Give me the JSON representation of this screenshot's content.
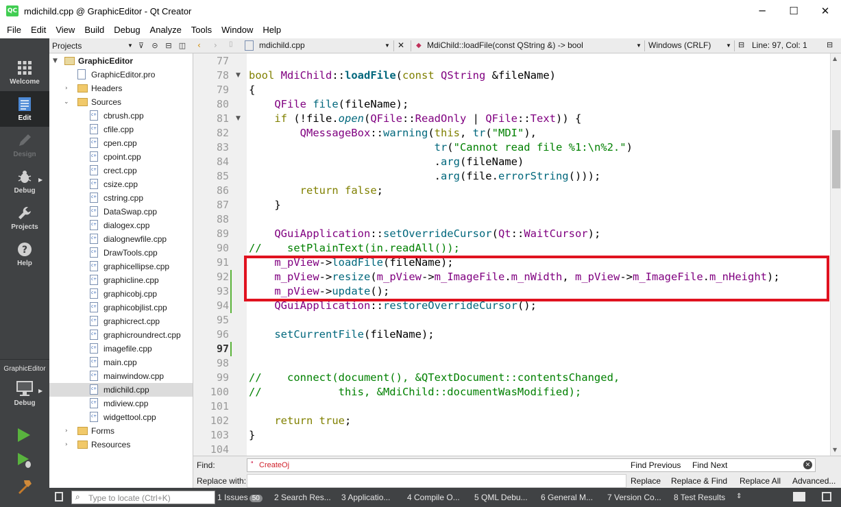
{
  "window": {
    "title": "mdichild.cpp @ GraphicEditor - Qt Creator",
    "app_icon": "QC",
    "controls": [
      "minimize-icon",
      "maximize-icon",
      "close-icon"
    ]
  },
  "menu": [
    "File",
    "Edit",
    "View",
    "Build",
    "Debug",
    "Analyze",
    "Tools",
    "Window",
    "Help"
  ],
  "modes": [
    {
      "label": "Welcome",
      "icon": "grid-icon"
    },
    {
      "label": "Edit",
      "icon": "document-icon"
    },
    {
      "label": "Design",
      "icon": "pen-icon"
    },
    {
      "label": "Debug",
      "icon": "bug-icon"
    },
    {
      "label": "Projects",
      "icon": "wrench-icon"
    },
    {
      "label": "Help",
      "icon": "question-icon"
    }
  ],
  "kit": {
    "project": "GraphicEditor",
    "mode": "Debug"
  },
  "projects_pane": {
    "title": "Projects",
    "tree": {
      "project": "GraphicEditor",
      "pro_file": "GraphicEditor.pro",
      "headers": "Headers",
      "sources": "Sources",
      "source_files": [
        "cbrush.cpp",
        "cfile.cpp",
        "cpen.cpp",
        "cpoint.cpp",
        "crect.cpp",
        "csize.cpp",
        "cstring.cpp",
        "DataSwap.cpp",
        "dialogex.cpp",
        "dialognewfile.cpp",
        "DrawTools.cpp",
        "graphicellipse.cpp",
        "graphicline.cpp",
        "graphicobj.cpp",
        "graphicobjlist.cpp",
        "graphicrect.cpp",
        "graphicroundrect.cpp",
        "imagefile.cpp",
        "main.cpp",
        "mainwindow.cpp",
        "mdichild.cpp",
        "mdiview.cpp",
        "widgettool.cpp"
      ],
      "selected_file": "mdichild.cpp",
      "forms": "Forms",
      "resources": "Resources"
    }
  },
  "editor_toolbar": {
    "file": "mdichild.cpp",
    "symbol": "MdiChild::loadFile(const QString &) -> bool",
    "line_endings": "Windows (CRLF)",
    "position": "Line: 97, Col: 1"
  },
  "code": {
    "current_line": "97",
    "lines": [
      {
        "n": "77",
        "t": ""
      },
      {
        "n": "78",
        "t": "bool MdiChild::loadFile(const QString &fileName)"
      },
      {
        "n": "79",
        "t": "{"
      },
      {
        "n": "80",
        "t": "    QFile file(fileName);"
      },
      {
        "n": "81",
        "t": "    if (!file.open(QFile::ReadOnly | QFile::Text)) {"
      },
      {
        "n": "82",
        "t": "        QMessageBox::warning(this, tr(\"MDI\"),"
      },
      {
        "n": "83",
        "t": "                             tr(\"Cannot read file %1:\\n%2.\")"
      },
      {
        "n": "84",
        "t": "                             .arg(fileName)"
      },
      {
        "n": "85",
        "t": "                             .arg(file.errorString()));"
      },
      {
        "n": "86",
        "t": "        return false;"
      },
      {
        "n": "87",
        "t": "    }"
      },
      {
        "n": "88",
        "t": ""
      },
      {
        "n": "89",
        "t": "    QGuiApplication::setOverrideCursor(Qt::WaitCursor);"
      },
      {
        "n": "90",
        "t": "//    setPlainText(in.readAll());"
      },
      {
        "n": "91",
        "t": "    m_pView->loadFile(fileName);"
      },
      {
        "n": "92",
        "t": "    m_pView->resize(m_pView->m_ImageFile.m_nWidth, m_pView->m_ImageFile.m_nHeight);"
      },
      {
        "n": "93",
        "t": "    m_pView->update();"
      },
      {
        "n": "94",
        "t": "    QGuiApplication::restoreOverrideCursor();"
      },
      {
        "n": "95",
        "t": ""
      },
      {
        "n": "96",
        "t": "    setCurrentFile(fileName);"
      },
      {
        "n": "97",
        "t": ""
      },
      {
        "n": "98",
        "t": ""
      },
      {
        "n": "99",
        "t": "//    connect(document(), &QTextDocument::contentsChanged,"
      },
      {
        "n": "100",
        "t": "//            this, &MdiChild::documentWasModified);"
      },
      {
        "n": "101",
        "t": ""
      },
      {
        "n": "102",
        "t": "    return true;"
      },
      {
        "n": "103",
        "t": "}"
      },
      {
        "n": "104",
        "t": ""
      }
    ]
  },
  "find": {
    "find_label": "Find:",
    "replace_label": "Replace with:",
    "find_value": "CreateOj",
    "replace_value": "",
    "find_previous": "Find Previous",
    "find_next": "Find Next",
    "replace": "Replace",
    "replace_find": "Replace & Find",
    "replace_all": "Replace All",
    "advanced": "Advanced..."
  },
  "status": {
    "locate_placeholder": "Type to locate (Ctrl+K)",
    "issues_label": "1  Issues",
    "issues_count": "50",
    "tabs": [
      "2  Search Res...",
      "3  Applicatio...",
      "4  Compile O...",
      "5  QML Debu...",
      "6  General M...",
      "7  Version Co...",
      "8  Test Results"
    ]
  },
  "colors": {
    "highlight_box": "#e0121f",
    "keyword": "#808000",
    "type": "#800080",
    "function": "#00677c",
    "string": "#008000",
    "comment": "#008000"
  }
}
